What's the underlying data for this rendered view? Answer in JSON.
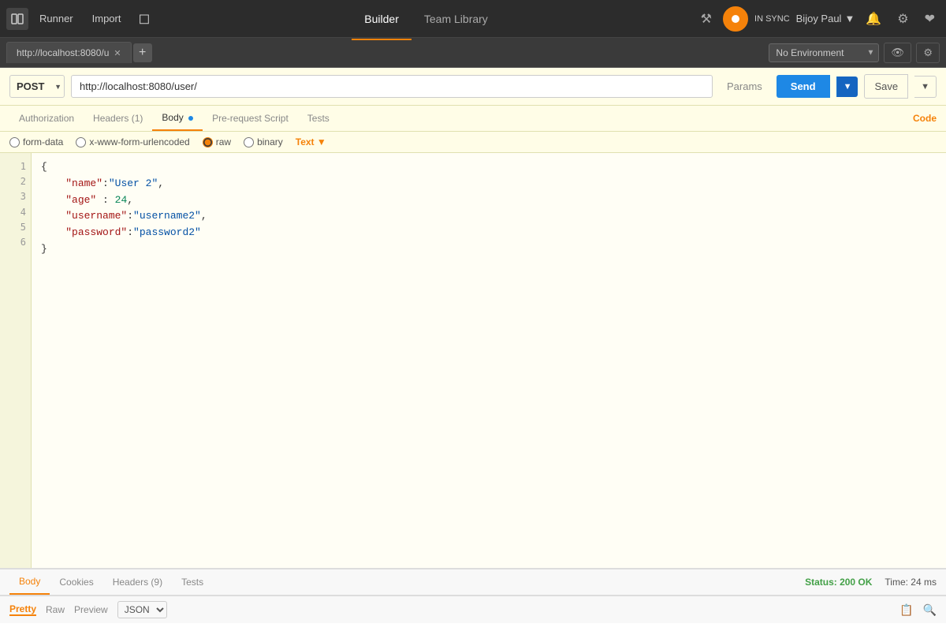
{
  "topnav": {
    "runner_label": "Runner",
    "import_label": "Import",
    "builder_label": "Builder",
    "team_library_label": "Team Library",
    "in_sync_label": "IN SYNC",
    "user_label": "Bijoy Paul"
  },
  "tabbar": {
    "tab1_label": "http://localhost:8080/u",
    "env_label": "No Environment",
    "add_tab_label": "+"
  },
  "request": {
    "method": "POST",
    "url": "http://localhost:8080/user/",
    "params_label": "Params",
    "send_label": "Send",
    "save_label": "Save"
  },
  "request_tabs": {
    "authorization_label": "Authorization",
    "headers_label": "Headers (1)",
    "body_label": "Body",
    "pre_request_label": "Pre-request Script",
    "tests_label": "Tests",
    "code_label": "Code"
  },
  "body_options": {
    "form_data_label": "form-data",
    "urlencoded_label": "x-www-form-urlencoded",
    "raw_label": "raw",
    "binary_label": "binary",
    "text_label": "Text"
  },
  "code_editor": {
    "lines": [
      "1",
      "2",
      "3",
      "4",
      "5",
      "6"
    ],
    "content": "{\n    \"name\":\"User 2\",\n    \"age\" : 24,\n    \"username\":\"username2\",\n    \"password\":\"password2\"\n}"
  },
  "response_tabs": {
    "body_label": "Body",
    "cookies_label": "Cookies",
    "headers_label": "Headers (9)",
    "tests_label": "Tests",
    "status_label": "Status: 200 OK",
    "time_label": "Time: 24 ms"
  },
  "response_bottom": {
    "pretty_label": "Pretty",
    "raw_label": "Raw",
    "preview_label": "Preview",
    "json_label": "JSON"
  }
}
